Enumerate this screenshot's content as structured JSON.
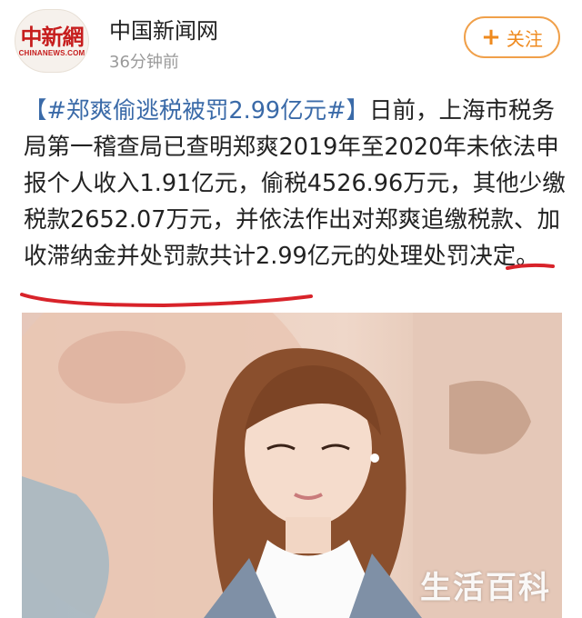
{
  "header": {
    "logo_cn": "中新網",
    "logo_en": "CHINANEWS.COM",
    "account_name": "中国新闻网",
    "post_time": "36分钟前",
    "follow_label": "关注"
  },
  "post": {
    "hashtag": "【#郑爽偷逃税被罚2.99亿元#】",
    "body": "日前，上海市税务局第一稽查局已查明郑爽2019年至2020年未依法申报个人收入1.91亿元，偷税4526.96万元，其他少缴税款2652.07万元，并依法作出对郑爽追缴税款、加收滞纳金并处罚款共计2.99亿元的处理处罚决定。"
  },
  "watermark": "生活百科",
  "colors": {
    "hashtag": "#3a6aa8",
    "follow": "#ef8a1e",
    "underline": "#d8232a",
    "logo": "#c61d1d"
  }
}
